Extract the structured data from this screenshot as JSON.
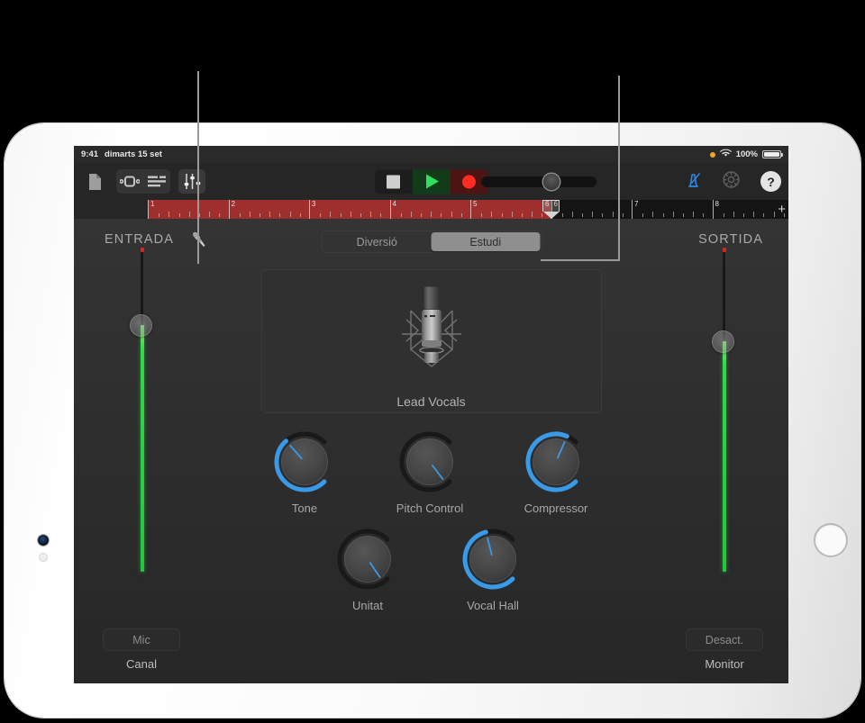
{
  "device": {
    "name": "ipad-frame"
  },
  "status_bar": {
    "time": "9:41",
    "date": "dimarts 15 set",
    "battery_percent": "100%",
    "record_indicator": "orange-dot-icon",
    "wifi": "wifi-icon"
  },
  "toolbar": {
    "left_icons": [
      {
        "name": "my-songs-icon",
        "glyph": "document"
      },
      {
        "name": "loop-browser-icon",
        "glyph": "cycle"
      },
      {
        "name": "track-view-icon",
        "glyph": "tracks"
      },
      {
        "name": "mixer-fader-icon",
        "glyph": "faders"
      }
    ],
    "transport": {
      "stop_label": "stop-button",
      "play_label": "play-button",
      "record_label": "record-button"
    },
    "master_volume": {
      "name": "master-volume-slider",
      "value": 61
    },
    "right_icons": [
      {
        "name": "metronome-icon"
      },
      {
        "name": "settings-gear-icon"
      },
      {
        "name": "help-icon",
        "glyph": "?"
      }
    ]
  },
  "ruler": {
    "bars": [
      "1",
      "2",
      "3",
      "4",
      "5",
      "6",
      "7",
      "8"
    ],
    "cycle_start_bar": 1,
    "cycle_end_bar": 6,
    "playhead_bar": "6",
    "add_section_label": "+"
  },
  "panel": {
    "input_label": "ENTRADA",
    "output_label": "SORTIDA",
    "input_source_icon": "microphone-icon",
    "view_modes": [
      {
        "label": "Diversió",
        "selected": false
      },
      {
        "label": "Estudi",
        "selected": true
      }
    ],
    "instrument": {
      "name": "Lead Vocals",
      "icon": "condenser-microphone-icon"
    },
    "input_fader": {
      "name": "input-volume-fader",
      "value": 76
    },
    "output_fader": {
      "name": "output-volume-fader",
      "value": 71
    },
    "knobs": [
      {
        "label": "Tone",
        "value": 68,
        "arc": true
      },
      {
        "label": "Pitch Control",
        "value": 3,
        "arc": false
      },
      {
        "label": "Compressor",
        "value": 92,
        "arc": true
      },
      {
        "label": "Unitat",
        "value": 4,
        "arc": false
      },
      {
        "label": "Vocal Hall",
        "value": 78,
        "arc": true
      }
    ],
    "channel": {
      "button_label": "Mic",
      "caption": "Canal"
    },
    "monitor": {
      "button_label": "Desact.",
      "caption": "Monitor"
    }
  },
  "colors": {
    "accent_blue": "#3a9ae8",
    "fader_green": "#2fd94a",
    "cycle_red": "#9e2f2c",
    "record_red": "#ff2d21",
    "play_green": "#2ee05e",
    "callout_gray": "#9a9a9a"
  }
}
